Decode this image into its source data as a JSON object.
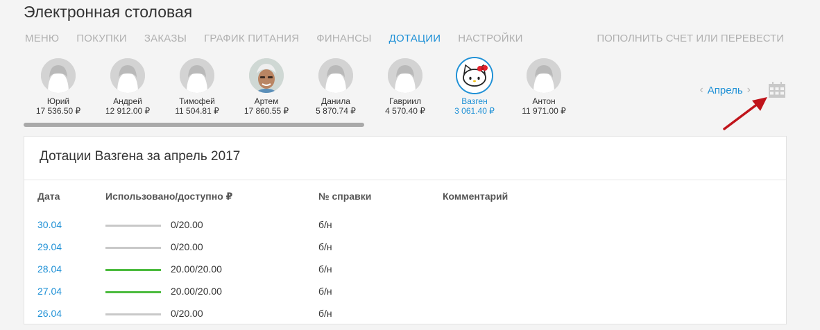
{
  "app": {
    "title": "Электронная столовая"
  },
  "nav": {
    "tabs": [
      {
        "label": "МЕНЮ",
        "active": false
      },
      {
        "label": "ПОКУПКИ",
        "active": false
      },
      {
        "label": "ЗАКАЗЫ",
        "active": false
      },
      {
        "label": "ГРАФИК ПИТАНИЯ",
        "active": false
      },
      {
        "label": "ФИНАНСЫ",
        "active": false
      },
      {
        "label": "ДОТАЦИИ",
        "active": true
      },
      {
        "label": "НАСТРОЙКИ",
        "active": false
      }
    ],
    "topup_label": "ПОПОЛНИТЬ СЧЕТ ИЛИ ПЕРЕВЕСТИ"
  },
  "users": [
    {
      "name": "Юрий",
      "balance": "17 536.50 ₽",
      "avatar": "default-avatar-icon",
      "selected": false
    },
    {
      "name": "Андрей",
      "balance": "12 912.00 ₽",
      "avatar": "default-avatar-icon",
      "selected": false
    },
    {
      "name": "Тимофей",
      "balance": "11 504.81 ₽",
      "avatar": "default-avatar-icon",
      "selected": false
    },
    {
      "name": "Артем",
      "balance": "17 860.55 ₽",
      "avatar": "photo-avatar",
      "selected": false
    },
    {
      "name": "Данила",
      "balance": "5 870.74 ₽",
      "avatar": "default-avatar-icon",
      "selected": false
    },
    {
      "name": "Гавриил",
      "balance": "4 570.40 ₽",
      "avatar": "default-avatar-icon",
      "selected": false
    },
    {
      "name": "Вазген",
      "balance": "3 061.40 ₽",
      "avatar": "hello-kitty-avatar",
      "selected": true
    },
    {
      "name": "Антон",
      "balance": "11 971.00 ₽",
      "avatar": "default-avatar-icon",
      "selected": false
    }
  ],
  "month_nav": {
    "label": "Апрель",
    "prev_icon": "chevron-left-icon",
    "next_icon": "chevron-right-icon",
    "calendar_icon": "calendar-icon"
  },
  "colors": {
    "accent": "#1e90d6",
    "used_bar": "#4cbb3e",
    "empty_bar": "#c8c8c8",
    "annotation_arrow": "#c0141b"
  },
  "panel": {
    "title": "Дотации Вазгена за апрель 2017",
    "columns": {
      "date": "Дата",
      "usage": "Использовано/доступно ₽",
      "cert": "№ справки",
      "comment": "Комментарий"
    },
    "rows": [
      {
        "date": "30.04",
        "usage": "0/20.00",
        "used_fraction": 0,
        "cert": "б/н",
        "comment": ""
      },
      {
        "date": "29.04",
        "usage": "0/20.00",
        "used_fraction": 0,
        "cert": "б/н",
        "comment": ""
      },
      {
        "date": "28.04",
        "usage": "20.00/20.00",
        "used_fraction": 1,
        "cert": "б/н",
        "comment": ""
      },
      {
        "date": "27.04",
        "usage": "20.00/20.00",
        "used_fraction": 1,
        "cert": "б/н",
        "comment": ""
      },
      {
        "date": "26.04",
        "usage": "0/20.00",
        "used_fraction": 0,
        "cert": "б/н",
        "comment": ""
      }
    ]
  }
}
